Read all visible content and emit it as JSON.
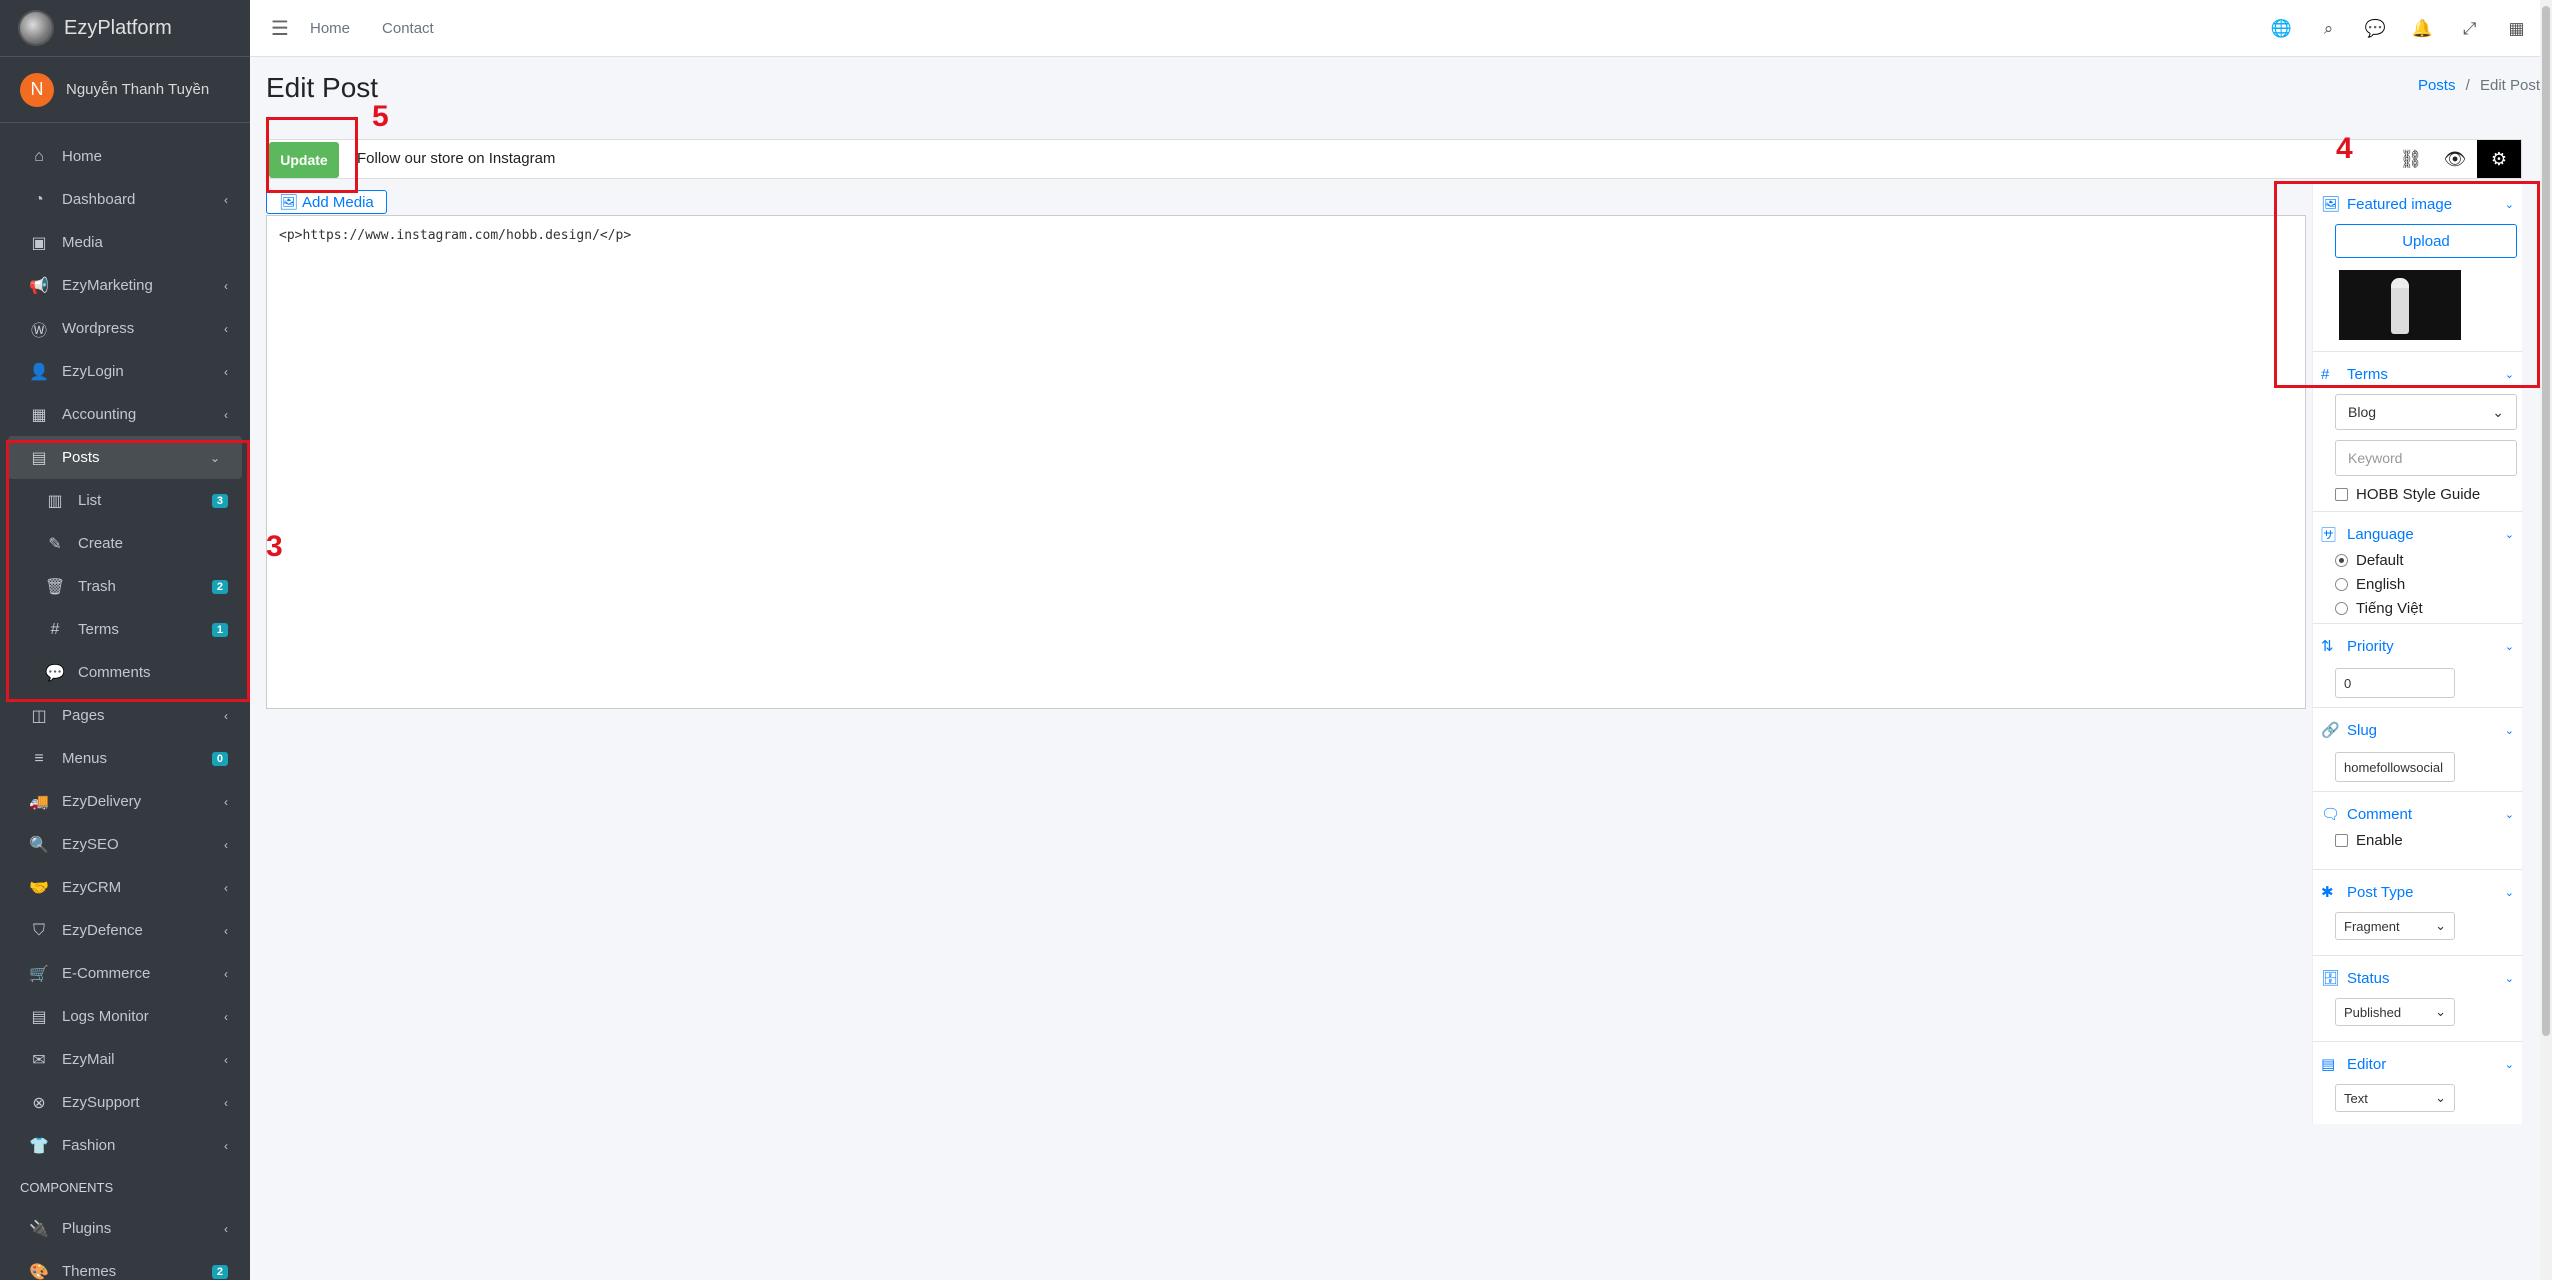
{
  "brand": {
    "name": "EzyPlatform"
  },
  "user": {
    "initial": "N",
    "name": "Nguyễn Thanh Tuyền"
  },
  "sidebar": {
    "items": [
      {
        "label": "Home",
        "icon": "home-icon",
        "glyph": "⌂"
      },
      {
        "label": "Dashboard",
        "icon": "dashboard-icon",
        "glyph": "◔",
        "chevron": "‹"
      },
      {
        "label": "Media",
        "icon": "image-icon",
        "glyph": "▣"
      },
      {
        "label": "EzyMarketing",
        "icon": "bullhorn-icon",
        "glyph": "📢",
        "chevron": "‹"
      },
      {
        "label": "Wordpress",
        "icon": "wordpress-icon",
        "glyph": "Ⓦ",
        "chevron": "‹"
      },
      {
        "label": "EzyLogin",
        "icon": "user-lock-icon",
        "glyph": "👤",
        "chevron": "‹"
      },
      {
        "label": "Accounting",
        "icon": "calculator-icon",
        "glyph": "▦",
        "chevron": "‹"
      },
      {
        "label": "Posts",
        "icon": "posts-icon",
        "glyph": "▤",
        "chevron": "⌄"
      },
      {
        "label": "List",
        "icon": "list-icon",
        "glyph": "▥",
        "badge": "3"
      },
      {
        "label": "Create",
        "icon": "edit-icon",
        "glyph": "✎"
      },
      {
        "label": "Trash",
        "icon": "trash-icon",
        "glyph": "🗑",
        "badge": "2"
      },
      {
        "label": "Terms",
        "icon": "hashtag-icon",
        "glyph": "#",
        "badge": "1"
      },
      {
        "label": "Comments",
        "icon": "comments-icon",
        "glyph": "💬"
      },
      {
        "label": "Pages",
        "icon": "pages-icon",
        "glyph": "◫",
        "chevron": "‹"
      },
      {
        "label": "Menus",
        "icon": "menu-icon",
        "glyph": "≡",
        "badge": "0"
      },
      {
        "label": "EzyDelivery",
        "icon": "truck-icon",
        "glyph": "🚚",
        "chevron": "‹"
      },
      {
        "label": "EzySEO",
        "icon": "search-plus-icon",
        "glyph": "🔍",
        "chevron": "‹"
      },
      {
        "label": "EzyCRM",
        "icon": "handshake-icon",
        "glyph": "🤝",
        "chevron": "‹"
      },
      {
        "label": "EzyDefence",
        "icon": "shield-icon",
        "glyph": "⛉",
        "chevron": "‹"
      },
      {
        "label": "E-Commerce",
        "icon": "cart-icon",
        "glyph": "🛒",
        "chevron": "‹"
      },
      {
        "label": "Logs Monitor",
        "icon": "logs-icon",
        "glyph": "▤",
        "chevron": "‹"
      },
      {
        "label": "EzyMail",
        "icon": "envelope-icon",
        "glyph": "✉",
        "chevron": "‹"
      },
      {
        "label": "EzySupport",
        "icon": "lifering-icon",
        "glyph": "⊗",
        "chevron": "‹"
      },
      {
        "label": "Fashion",
        "icon": "tshirt-icon",
        "glyph": "👕",
        "chevron": "‹"
      }
    ],
    "components_header": "COMPONENTS",
    "components": [
      {
        "label": "Plugins",
        "icon": "plug-icon",
        "glyph": "🔌",
        "chevron": "‹"
      },
      {
        "label": "Themes",
        "icon": "palette-icon",
        "glyph": "🎨",
        "badge": "2"
      }
    ]
  },
  "topbar": {
    "home": "Home",
    "contact": "Contact"
  },
  "page": {
    "title": "Edit Post",
    "breadcrumb_posts": "Posts",
    "breadcrumb_sep": "/",
    "breadcrumb_current": "Edit Post"
  },
  "editor": {
    "update_label": "Update",
    "post_title": "Follow our store on Instagram",
    "add_media": "Add Media",
    "content": "<p>https://www.instagram.com/hobb.design/</p>"
  },
  "panel": {
    "featured_image": "Featured image",
    "upload": "Upload",
    "terms": "Terms",
    "terms_select": "Blog",
    "keyword_placeholder": "Keyword",
    "hobb_style": "HOBB Style Guide",
    "language": "Language",
    "lang_default": "Default",
    "lang_english": "English",
    "lang_vi": "Tiếng Việt",
    "priority": "Priority",
    "priority_value": "0",
    "slug": "Slug",
    "slug_value": "homefollowsocial",
    "comment": "Comment",
    "comment_enable": "Enable",
    "post_type": "Post Type",
    "post_type_value": "Fragment",
    "status": "Status",
    "status_value": "Published",
    "editor": "Editor",
    "editor_value": "Text"
  },
  "annotations": {
    "n3": "3",
    "n4": "4",
    "n5": "5"
  },
  "colors": {
    "sidebar": "#343a40",
    "accent": "#007bff",
    "update": "#5cb85c",
    "highlight": "#e0131f"
  }
}
